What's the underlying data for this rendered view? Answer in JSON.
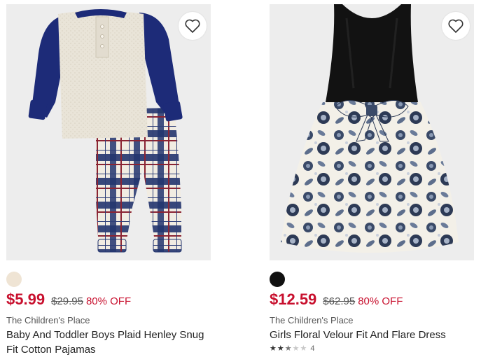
{
  "products": [
    {
      "swatch_color": "#efe4d4",
      "price_sale": "$5.99",
      "price_original": "$29.95",
      "discount": "80% OFF",
      "brand": "The Children's Place",
      "title": "Baby And Toddler Boys Plaid Henley Snug Fit Cotton Pajamas",
      "wishlist_icon": "heart-outline-icon"
    },
    {
      "swatch_color": "#111111",
      "price_sale": "$12.59",
      "price_original": "$62.95",
      "discount": "80% OFF",
      "brand": "The Children's Place",
      "title": "Girls Floral Velour Fit And Flare Dress",
      "rating": 2.5,
      "rating_max": 5,
      "review_count": "4",
      "wishlist_icon": "heart-outline-icon"
    }
  ]
}
